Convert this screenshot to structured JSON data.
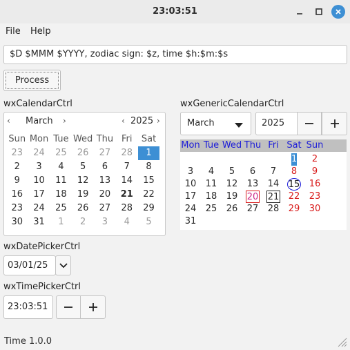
{
  "window": {
    "title": "23:03:51"
  },
  "menu": {
    "file": "File",
    "help": "Help"
  },
  "format_input": {
    "value": "$D $MMM $YYYY, zodiac sign: $z, time $h:$m:$s"
  },
  "process_button": "Process",
  "calendar_ctrl": {
    "label": "wxCalendarCtrl",
    "month": "March",
    "year": "2025",
    "weekdays": [
      "Sun",
      "Mon",
      "Tue",
      "Wed",
      "Thu",
      "Fri",
      "Sat"
    ],
    "weeks": [
      [
        "23",
        "24",
        "25",
        "26",
        "27",
        "28",
        "1"
      ],
      [
        "2",
        "3",
        "4",
        "5",
        "6",
        "7",
        "8"
      ],
      [
        "9",
        "10",
        "11",
        "12",
        "13",
        "14",
        "15"
      ],
      [
        "16",
        "17",
        "18",
        "19",
        "20",
        "21",
        "22"
      ],
      [
        "23",
        "24",
        "25",
        "26",
        "27",
        "28",
        "29"
      ],
      [
        "30",
        "31",
        "1",
        "2",
        "3",
        "4",
        "5"
      ]
    ]
  },
  "generic_calendar": {
    "label": "wxGenericCalendarCtrl",
    "month": "March",
    "year": "2025",
    "weekdays": [
      "Mon",
      "Tue",
      "Wed",
      "Thu",
      "Fri",
      "Sat",
      "Sun"
    ],
    "weeks": [
      [
        "",
        "",
        "",
        "",
        "",
        "1",
        "2"
      ],
      [
        "3",
        "4",
        "5",
        "6",
        "7",
        "8",
        "9"
      ],
      [
        "10",
        "11",
        "12",
        "13",
        "14",
        "15",
        "16"
      ],
      [
        "17",
        "18",
        "19",
        "20",
        "21",
        "22",
        "23"
      ],
      [
        "24",
        "25",
        "26",
        "27",
        "28",
        "29",
        "30"
      ],
      [
        "31",
        "",
        "",
        "",
        "",
        "",
        ""
      ]
    ]
  },
  "date_picker": {
    "label": "wxDatePickerCtrl",
    "value": "03/01/25"
  },
  "time_picker": {
    "label": "wxTimePickerCtrl",
    "value": "23:03:51"
  },
  "status": "Time 1.0.0",
  "colors": {
    "accent": "#3d8fd4",
    "weekend": "#d81a1a",
    "header": "#1a1ad8",
    "holiday": "#cc2a8a"
  }
}
